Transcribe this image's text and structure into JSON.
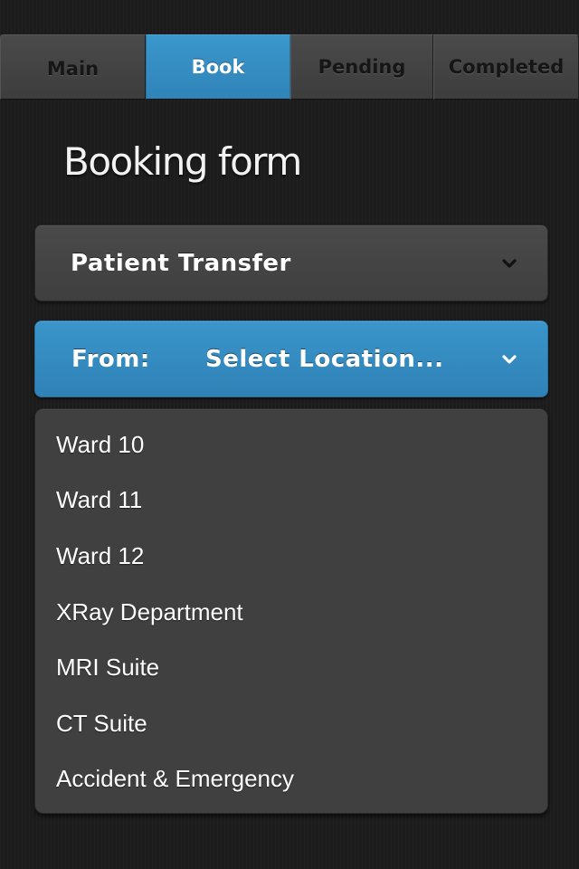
{
  "tabs": [
    {
      "label": "Main",
      "active": false
    },
    {
      "label": "Book",
      "active": true
    },
    {
      "label": "Pending",
      "active": false
    },
    {
      "label": "Completed",
      "active": false
    }
  ],
  "page_title": "Booking form",
  "booking_type": {
    "value": "Patient Transfer",
    "icon": "chevron-down-icon"
  },
  "from_select": {
    "label": "From:",
    "value": "Select Location...",
    "icon": "chevron-down-icon"
  },
  "location_options": [
    "Ward 10",
    "Ward 11",
    "Ward 12",
    "XRay Department",
    "MRI Suite",
    "CT Suite",
    "Accident & Emergency"
  ],
  "colors": {
    "accent": "#3390c4",
    "background": "#1c1c1c",
    "panel": "#404040",
    "tab_inactive": "#424242"
  }
}
